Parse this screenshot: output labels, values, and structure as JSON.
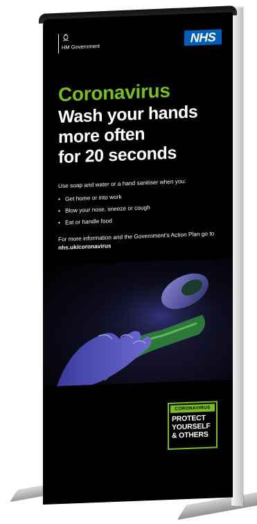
{
  "banner": {
    "government": "HM Government",
    "nhs_logo": "NHS",
    "kicker": "Coronavirus",
    "headline_lines": [
      "Wash your hands",
      "more often",
      "for 20 seconds"
    ],
    "intro": "Use soap and water or a hand sanitiser when you:",
    "bullets": [
      "Get home or into work",
      "Blow your nose, sneeze or cough",
      "Eat or handle food"
    ],
    "more_info": "For more information and the Government's Action Plan go to",
    "url": "nhs.uk/coronavirus",
    "protect": {
      "tag": "CORONAVIRUS",
      "lines": [
        "PROTECT",
        "YOURSELF",
        "& OTHERS"
      ]
    },
    "colors": {
      "accent_green": "#78be20",
      "nhs_blue": "#005eb8",
      "background": "#000000"
    },
    "icons": [
      "crest-icon"
    ]
  }
}
